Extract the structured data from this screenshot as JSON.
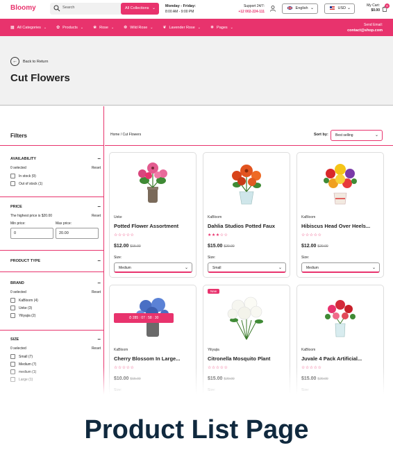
{
  "header": {
    "logo": "Bloomy",
    "search_placeholder": "Search",
    "category_select": "All Collections",
    "hours_title": "Monday - Friday:",
    "hours_value": "8:00 AM - 9:00 PM",
    "support_title": "Support 24/7:",
    "support_phone": "+12 002-224-111",
    "language": "English",
    "currency": "USD",
    "cart_label": "My Cart:",
    "cart_amount": "$0.00",
    "cart_count": "0"
  },
  "nav": {
    "items": [
      {
        "label": "All Categories",
        "icon": "grid-icon"
      },
      {
        "label": "Products",
        "icon": "flower-icon"
      },
      {
        "label": "Rose",
        "icon": "rose-icon"
      },
      {
        "label": "Wild Rose",
        "icon": "wild-rose-icon"
      },
      {
        "label": "Lavender Rose",
        "icon": "lavender-icon"
      },
      {
        "label": "Pages",
        "icon": "pages-icon"
      }
    ],
    "email_title": "Send Email:",
    "email_value": "contact@shop.com"
  },
  "banner": {
    "back_label": "Back to Return",
    "title": "Cut Flowers"
  },
  "filters": {
    "title": "Filters",
    "reset_label": "Reset",
    "availability": {
      "title": "AVAILABILITY",
      "selected": "0 selected",
      "options": [
        "In stock (9)",
        "Out of stock (1)"
      ]
    },
    "price": {
      "title": "PRICE",
      "note": "The highest price is $20.00",
      "min_label": "Min price:",
      "max_label": "Max price:",
      "min_value": "0",
      "max_value": "20.00"
    },
    "product_type": {
      "title": "PRODUCT TYPE"
    },
    "brand": {
      "title": "BRAND",
      "selected": "0 selected",
      "options": [
        "KaBloom (4)",
        "Ueke (3)",
        "Yiliyajia (2)"
      ]
    },
    "size": {
      "title": "SIZE",
      "selected": "0 selected",
      "options": [
        "Small (7)",
        "Medium (7)",
        "medium (1)",
        "Large (1)"
      ]
    }
  },
  "listing": {
    "breadcrumb_home": "Home",
    "breadcrumb_sep": "/",
    "breadcrumb_current": "Cut Flowers",
    "sort_label": "Sort by:",
    "sort_value": "Best selling",
    "size_label": "Size:",
    "products": [
      {
        "vendor": "Ueke",
        "name": "Potted Flower Assortment",
        "price": "$12.00",
        "old_price": "$15.00",
        "rating": 0,
        "size": "Medium"
      },
      {
        "vendor": "KaBloom",
        "name": "Dahlia Studios Potted Faux",
        "price": "$15.00",
        "old_price": "$20.00",
        "rating": 3,
        "size": "Small"
      },
      {
        "vendor": "KaBloom",
        "name": "Hibiscus Head Over Heels...",
        "price": "$12.00",
        "old_price": "$20.00",
        "rating": 0,
        "size": "Medium"
      },
      {
        "vendor": "KaBloom",
        "name": "Cherry Blossom In Large...",
        "price": "$10.00",
        "old_price": "$15.00",
        "rating": 0,
        "countdown": "285 : 07 : 58 : 30"
      },
      {
        "vendor": "Yiliyajia",
        "name": "Citronella Mosquito Plant",
        "price": "$15.00",
        "old_price": "$20.00",
        "rating": 0,
        "badge": "New"
      },
      {
        "vendor": "KaBloom",
        "name": "Juvale 4 Pack Artificial...",
        "price": "$15.00",
        "old_price": "$20.00",
        "rating": 0
      }
    ]
  },
  "caption": "Product List Page",
  "colors": {
    "accent": "#e8336d",
    "caption": "#10293e",
    "banner": "#f1f1f1"
  }
}
